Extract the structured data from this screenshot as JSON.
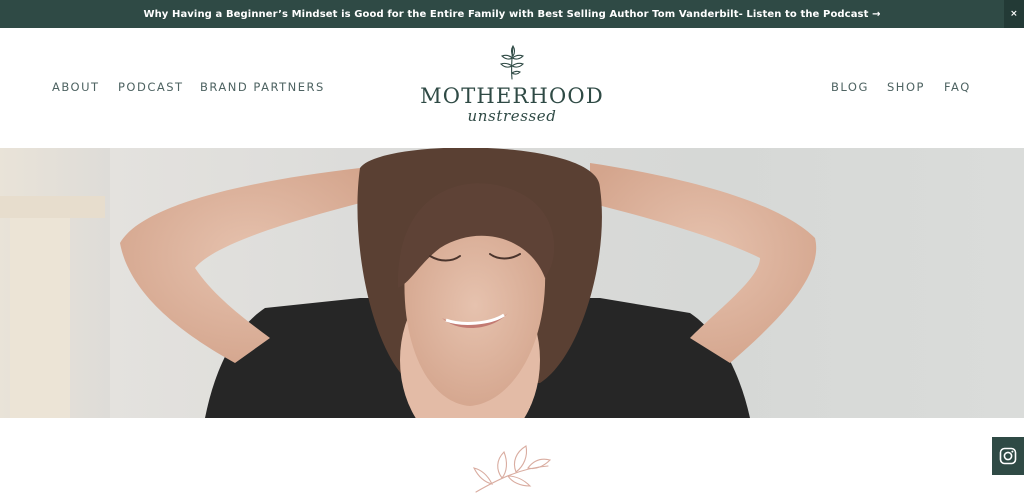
{
  "announcement": {
    "text": "Why Having a Beginner’s Mindset is Good for the Entire Family with Best Selling Author Tom Vanderbilt- Listen to the Podcast →",
    "close_label": "×"
  },
  "nav_left": [
    {
      "label": "ABOUT"
    },
    {
      "label": "PODCAST"
    },
    {
      "label": "BRAND PARTNERS"
    }
  ],
  "nav_right": [
    {
      "label": "BLOG"
    },
    {
      "label": "SHOP"
    },
    {
      "label": "FAQ"
    }
  ],
  "logo": {
    "title": "MOTHERHOOD",
    "subtitle": "unstressed",
    "icon": "leaf-sprig-icon"
  },
  "hero": {
    "description_icon": "hero-photo"
  },
  "decor": {
    "icon": "leaf-branch-icon",
    "color": "#d9aca0"
  },
  "social": {
    "icon": "instagram-icon"
  },
  "colors": {
    "brand_dark_green": "#2f4a45",
    "nav_text": "#4e6362",
    "accent_blush": "#d9aca0"
  }
}
